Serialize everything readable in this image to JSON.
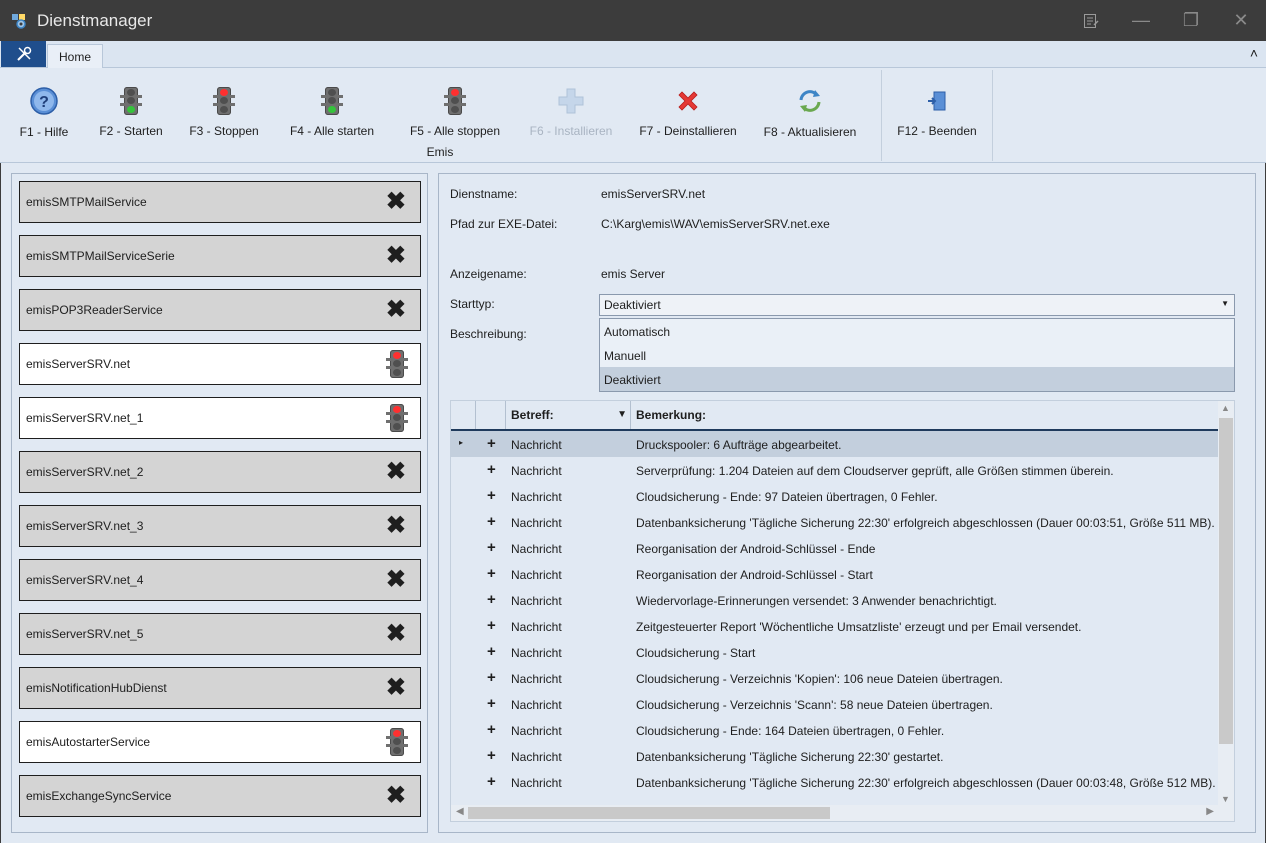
{
  "window": {
    "title": "Dienstmanager",
    "controls": [
      "notes-icon",
      "minimize-icon",
      "maximize-icon",
      "close-icon"
    ]
  },
  "ribbon": {
    "tab": "Home",
    "group": "Emis",
    "buttons": [
      {
        "label": "F1 - Hilfe",
        "icon": "help-icon",
        "enabled": true
      },
      {
        "label": "F2 - Starten",
        "icon": "traffic-light-green-icon",
        "enabled": true
      },
      {
        "label": "F3 - Stoppen",
        "icon": "traffic-light-red-icon",
        "enabled": true
      },
      {
        "label": "F4 - Alle starten",
        "icon": "traffic-light-green-icon",
        "enabled": true
      },
      {
        "label": "F5 - Alle stoppen",
        "icon": "traffic-light-red-icon",
        "enabled": true
      },
      {
        "label": "F6 - Installieren",
        "icon": "plus-icon",
        "enabled": false
      },
      {
        "label": "F7 - Deinstallieren",
        "icon": "red-x-icon",
        "enabled": true
      },
      {
        "label": "F8 - Aktualisieren",
        "icon": "refresh-icon",
        "enabled": true
      },
      {
        "label": "F12 - Beenden",
        "icon": "exit-door-icon",
        "enabled": true
      }
    ]
  },
  "services": [
    {
      "name": "emisSMTPMailService",
      "status": "not-installed"
    },
    {
      "name": "emisSMTPMailServiceSerie",
      "status": "not-installed"
    },
    {
      "name": "emisPOP3ReaderService",
      "status": "not-installed"
    },
    {
      "name": "emisServerSRV.net",
      "status": "stopped"
    },
    {
      "name": "emisServerSRV.net_1",
      "status": "stopped"
    },
    {
      "name": "emisServerSRV.net_2",
      "status": "not-installed"
    },
    {
      "name": "emisServerSRV.net_3",
      "status": "not-installed"
    },
    {
      "name": "emisServerSRV.net_4",
      "status": "not-installed"
    },
    {
      "name": "emisServerSRV.net_5",
      "status": "not-installed"
    },
    {
      "name": "emisNotificationHubDienst",
      "status": "not-installed"
    },
    {
      "name": "emisAutostarterService",
      "status": "stopped"
    },
    {
      "name": "emisExchangeSyncService",
      "status": "not-installed"
    }
  ],
  "details": {
    "dienstname_label": "Dienstname:",
    "dienstname": "emisServerSRV.net",
    "pfad_label": "Pfad zur EXE-Datei:",
    "pfad": "C:\\Karg\\emis\\WAV\\emisServerSRV.net.exe",
    "anzeigename_label": "Anzeigename:",
    "anzeigename": "emis Server",
    "starttyp_label": "Starttyp:",
    "starttyp": "Deaktiviert",
    "starttyp_options": [
      "Automatisch",
      "Manuell",
      "Deaktiviert"
    ],
    "beschreibung_label": "Beschreibung:"
  },
  "log_grid": {
    "columns": [
      "Betreff:",
      "Bemerkung:"
    ],
    "rows": [
      {
        "betreff": "Nachricht",
        "bemerkung": "Druckspooler: 6 Aufträge abgearbeitet."
      },
      {
        "betreff": "Nachricht",
        "bemerkung": "Serverprüfung: 1.204 Dateien auf dem Cloudserver geprüft, alle Größen stimmen überein."
      },
      {
        "betreff": "Nachricht",
        "bemerkung": "Cloudsicherung - Ende: 97 Dateien übertragen, 0 Fehler."
      },
      {
        "betreff": "Nachricht",
        "bemerkung": "Datenbanksicherung 'Tägliche Sicherung 22:30' erfolgreich abgeschlossen (Dauer 00:03:51, Größe 511 MB)."
      },
      {
        "betreff": "Nachricht",
        "bemerkung": "Reorganisation der Android-Schlüssel - Ende"
      },
      {
        "betreff": "Nachricht",
        "bemerkung": "Reorganisation der Android-Schlüssel - Start"
      },
      {
        "betreff": "Nachricht",
        "bemerkung": "Wiedervorlage-Erinnerungen versendet: 3 Anwender benachrichtigt."
      },
      {
        "betreff": "Nachricht",
        "bemerkung": "Zeitgesteuerter Report 'Wöchentliche Umsatzliste' erzeugt und per Email versendet."
      },
      {
        "betreff": "Nachricht",
        "bemerkung": "Cloudsicherung - Start"
      },
      {
        "betreff": "Nachricht",
        "bemerkung": "Cloudsicherung - Verzeichnis 'Kopien': 106 neue Dateien übertragen."
      },
      {
        "betreff": "Nachricht",
        "bemerkung": "Cloudsicherung - Verzeichnis 'Scann': 58 neue Dateien übertragen."
      },
      {
        "betreff": "Nachricht",
        "bemerkung": "Cloudsicherung - Ende: 164 Dateien übertragen, 0 Fehler."
      },
      {
        "betreff": "Nachricht",
        "bemerkung": "Datenbanksicherung 'Tägliche Sicherung 22:30' gestartet."
      },
      {
        "betreff": "Nachricht",
        "bemerkung": "Datenbanksicherung 'Tägliche Sicherung 22:30' erfolgreich abgeschlossen (Dauer 00:03:48, Größe 512 MB)."
      }
    ]
  },
  "colors": {
    "accent": "#1f4e8c",
    "panel": "#e1e9f3",
    "selected_row": "#c3cfdd"
  }
}
